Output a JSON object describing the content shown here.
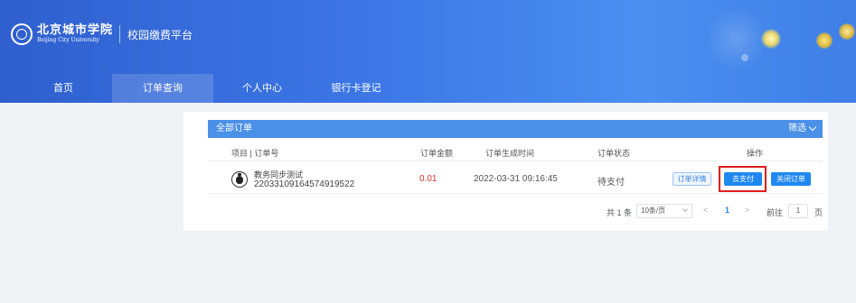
{
  "header": {
    "school_name_cn": "北京城市学院",
    "school_name_en": "Beijing City University",
    "platform_title": "校园缴费平台"
  },
  "nav": [
    {
      "label": "首页",
      "active": false
    },
    {
      "label": "订单查询",
      "active": true
    },
    {
      "label": "个人中心",
      "active": false
    },
    {
      "label": "银行卡登记",
      "active": false
    }
  ],
  "orders": {
    "card_title": "全部订单",
    "filter_label": "筛选",
    "columns": {
      "item": "项目 | 订单号",
      "amount": "订单金额",
      "created": "订单生成时间",
      "status": "订单状态",
      "actions": "操作"
    },
    "rows": [
      {
        "icon": "money-bag-icon",
        "item_name": "教务同步测试",
        "order_no": "22033109164574919522",
        "amount": "0.01",
        "created": "2022-03-31 09:16:45",
        "status": "待支付",
        "actions": {
          "detail": "订单详情",
          "pay": "去支付",
          "close": "关闭订单"
        }
      }
    ]
  },
  "pagination": {
    "total": "共 1 条",
    "page_size": "10条/页",
    "prev": "<",
    "current_page": "1",
    "next": ">",
    "goto_label": "前往",
    "goto_value": "1",
    "page_suffix": "页"
  },
  "colors": {
    "header_blue": "#3d78e6",
    "card_header": "#4a90e8",
    "button_blue": "#1e88f0",
    "amount_red": "#d6332c",
    "highlight_red": "#e01e1e"
  }
}
